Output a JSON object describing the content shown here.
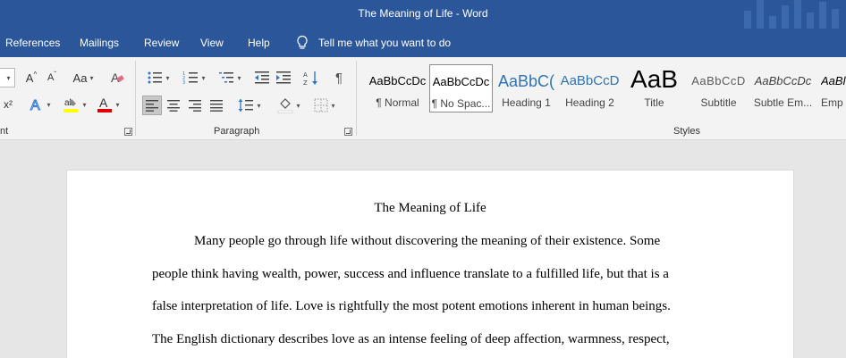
{
  "window": {
    "title": "The Meaning of Life  -  Word"
  },
  "menu": {
    "tabs": [
      "References",
      "Mailings",
      "Review",
      "View",
      "Help"
    ],
    "tell_me": "Tell me what you want to do"
  },
  "ribbon": {
    "font_group_label": "nt",
    "paragraph_group_label": "Paragraph",
    "styles_group_label": "Styles",
    "font_buttons": {
      "grow": "A",
      "shrink": "A",
      "case": "Aa",
      "superscript": "x²",
      "text_effects": "A",
      "highlight": "ab",
      "font_color": "A"
    },
    "styles": [
      {
        "sample": "AaBbCcDc",
        "name": "¶ Normal"
      },
      {
        "sample": "AaBbCcDc",
        "name": "¶ No Spac..."
      },
      {
        "sample": "AaBbC(",
        "name": "Heading 1"
      },
      {
        "sample": "AaBbCcD",
        "name": "Heading 2"
      },
      {
        "sample": "AaB",
        "name": "Title"
      },
      {
        "sample": "AaBbCcD",
        "name": "Subtitle"
      },
      {
        "sample": "AaBbCcDc",
        "name": "Subtle Em..."
      },
      {
        "sample": "AaBl",
        "name": "Emp"
      }
    ],
    "colors": {
      "highlight": "#ffff00",
      "font_color": "#e00000",
      "accent": "#2b579a"
    }
  },
  "document": {
    "title": "The Meaning of Life",
    "lines": [
      "Many people go through life without discovering the meaning of their existence. Some",
      "people think having wealth, power, success and influence translate to a fulfilled life, but that is a",
      "false interpretation of life. Love is rightfully the most potent emotions inherent in human beings.",
      "The English dictionary describes love as an intense feeling of deep affection, warmness, respect,"
    ]
  }
}
